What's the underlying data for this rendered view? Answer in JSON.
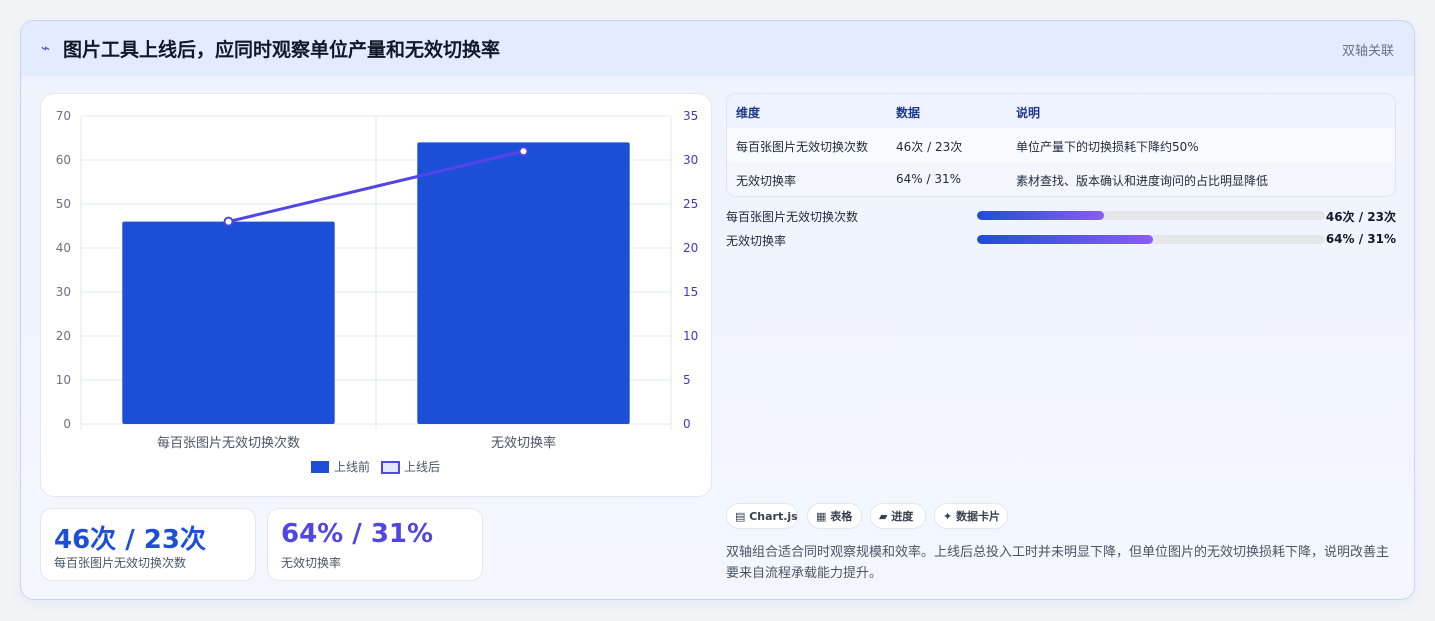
{
  "header": {
    "icon": "⌁",
    "title": "图片工具上线后，应同时观察单位产量和无效切换率",
    "badge": "双轴关联"
  },
  "colors": {
    "bar_before": "#1d4ed8",
    "line_after": "#4f46e5",
    "accent_blue": "#1d4ed8",
    "accent_purple": "#4f46e5"
  },
  "chart_data": {
    "type": "bar",
    "categories": [
      "每百张图片无效切换次数",
      "无效切换率"
    ],
    "series": [
      {
        "name": "上线前",
        "type": "bar",
        "axis": "left",
        "values": [
          46,
          64
        ]
      },
      {
        "name": "上线后",
        "type": "line",
        "axis": "right",
        "values": [
          23,
          31
        ]
      }
    ],
    "ylim": [
      0,
      70
    ],
    "yticks": [
      0,
      10,
      20,
      30,
      40,
      50,
      60,
      70
    ],
    "y2lim": [
      0,
      35
    ],
    "y2ticks": [
      0,
      5,
      10,
      15,
      20,
      25,
      30,
      35
    ],
    "grid": true,
    "legend_position": "bottom"
  },
  "stats": [
    {
      "value": "46次 / 23次",
      "label": "每百张图片无效切换次数"
    },
    {
      "value": "64% / 31%",
      "label": "无效切换率"
    }
  ],
  "table": {
    "headers": [
      "维度",
      "数据",
      "说明"
    ],
    "rows": [
      [
        "每百张图片无效切换次数",
        "46次 / 23次",
        "单位产量下的切换损耗下降约50%"
      ],
      [
        "无效切换率",
        "64% / 31%",
        "素材查找、版本确认和进度询问的占比明显降低"
      ]
    ]
  },
  "progress": [
    {
      "label": "每百张图片无效切换次数",
      "value": "46次 / 23次",
      "fraction": 0.365
    },
    {
      "label": "无效切换率",
      "value": "64% / 31%",
      "fraction": 0.505
    }
  ],
  "tags": [
    "▤ Chart.js",
    "▦ 表格",
    "▰ 进度",
    "✦ 数据卡片"
  ],
  "note": "双轴组合适合同时观察规模和效率。上线后总投入工时并未明显下降，但单位图片的无效切换损耗下降，说明改善主要来自流程承载能力提升。"
}
